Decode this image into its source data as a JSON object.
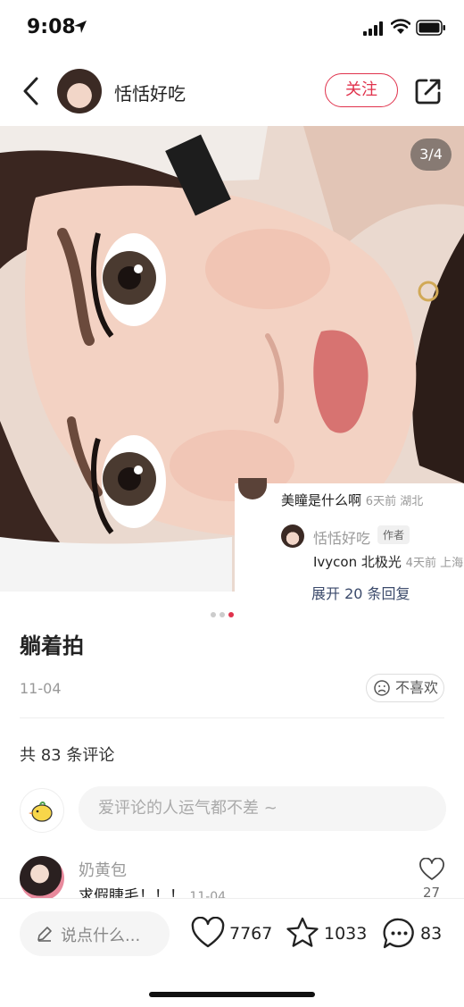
{
  "status_bar": {
    "time": "9:08",
    "icons": [
      "location-arrow-icon",
      "cellular-signal-icon",
      "wifi-icon",
      "battery-icon"
    ]
  },
  "header": {
    "back_icon": "chevron-left-icon",
    "author_name": "恬恬好吃",
    "follow_label": "关注",
    "share_icon": "share-icon",
    "accent_color": "#e0324c"
  },
  "photo": {
    "counter": "3/4",
    "preview": {
      "comment_text": "美瞳是什么啊",
      "comment_meta": "6天前 湖北",
      "reply_author": "恬恬好吃",
      "reply_badge": "作者",
      "reply_text": "Ivycon 北极光",
      "reply_meta": "4天前 上海",
      "expand_label": "展开 20 条回复"
    }
  },
  "post": {
    "title": "躺着拍",
    "date": "11-04",
    "dislike_label": "不喜欢"
  },
  "comments": {
    "count_label": "共 83 条评论",
    "input_placeholder": "爱评论的人运气都不差 ~",
    "items": [
      {
        "author": "奶黄包",
        "text": "求假睫毛！！！",
        "date": "11-04",
        "likes": "27"
      }
    ]
  },
  "bottom_bar": {
    "say_label": "说点什么...",
    "likes": "7767",
    "stars": "1033",
    "comments": "83"
  }
}
